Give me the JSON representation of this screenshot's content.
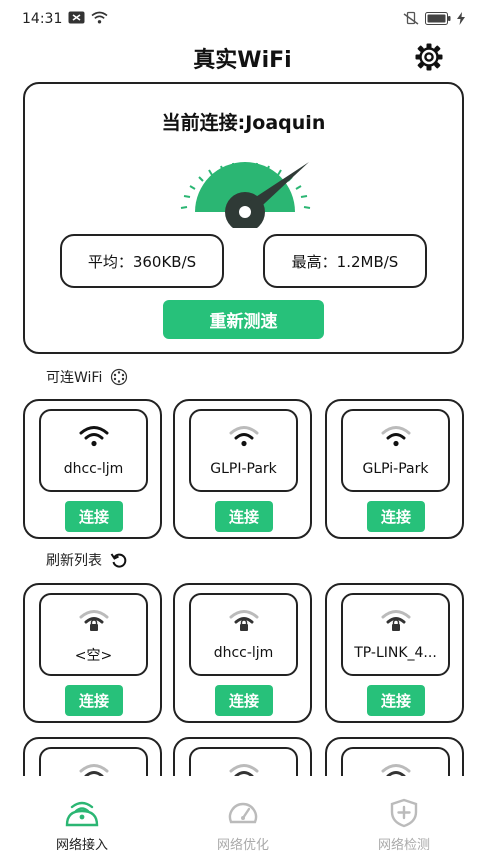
{
  "status_bar": {
    "time": "14:31"
  },
  "header": {
    "title": "真实WiFi",
    "settings_icon": "gear-icon"
  },
  "speed_card": {
    "title": "当前连接:Joaquin",
    "average": "平均：360KB/S",
    "max": "最高：1.2MB/S",
    "retest_label": "重新测速"
  },
  "sections": {
    "available": "可连WiFi",
    "refresh": "刷新列表"
  },
  "available_networks": [
    {
      "name": "dhcc-ljm",
      "connect": "连接"
    },
    {
      "name": "GLPI-Park",
      "connect": "连接"
    },
    {
      "name": "GLPi-Park",
      "connect": "连接"
    }
  ],
  "locked_networks": [
    {
      "name": "<空>",
      "connect": "连接"
    },
    {
      "name": "dhcc-ljm",
      "connect": "连接"
    },
    {
      "name": "TP-LINK_4...",
      "connect": "连接"
    }
  ],
  "nav": {
    "access": "网络接入",
    "optimize": "网络优化",
    "detect": "网络检测"
  },
  "colors": {
    "accent": "#27c17a"
  }
}
